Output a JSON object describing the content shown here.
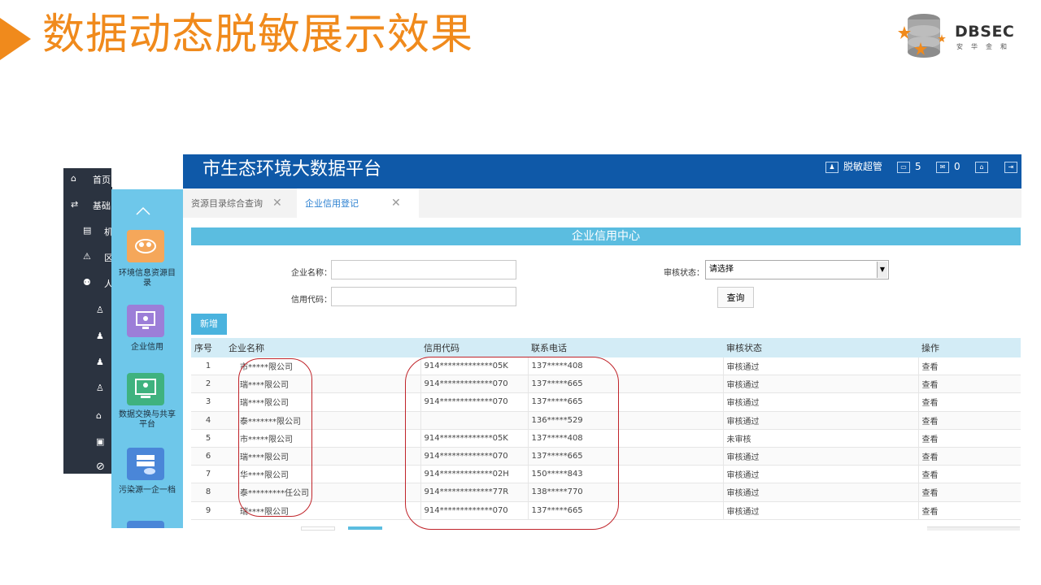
{
  "slide": {
    "title": "数据动态脱敏展示效果",
    "logo_text": "DBSEC",
    "logo_sub": "安华金和"
  },
  "colors": {
    "accent": "#f08a1c",
    "topbar": "#0f59a8",
    "sidebar": "#6ec7ea",
    "highlight": "#c0242a"
  },
  "dark_sidebar": {
    "items": [
      {
        "icon": "home-icon",
        "glyph": "⌂",
        "label": "首页"
      },
      {
        "icon": "swap-icon",
        "glyph": "⇄",
        "label": "基础"
      },
      {
        "icon": "doc-icon",
        "glyph": "▤",
        "label": "机"
      },
      {
        "icon": "region-icon",
        "glyph": "⚠",
        "label": "区"
      },
      {
        "icon": "user-icon",
        "glyph": "⚉",
        "label": "人"
      },
      {
        "icon": "user-outline-icon",
        "glyph": "♙",
        "label": ""
      },
      {
        "icon": "users-icon",
        "glyph": "♟",
        "label": ""
      },
      {
        "icon": "person-icon",
        "glyph": "♟",
        "label": ""
      },
      {
        "icon": "person-outline-icon",
        "glyph": "♙",
        "label": ""
      },
      {
        "icon": "house-icon",
        "glyph": "⌂",
        "label": ""
      },
      {
        "icon": "folder-icon",
        "glyph": "▣",
        "label": ""
      },
      {
        "icon": "ban-icon",
        "glyph": "⊘",
        "label": ""
      }
    ]
  },
  "blue_sidebar": {
    "items": [
      {
        "icon": "cloud-icon",
        "label": "环境信息资源目录"
      },
      {
        "icon": "monitor-icon",
        "label": "企业信用"
      },
      {
        "icon": "exchange-icon",
        "label": "数据交换与共享平台"
      },
      {
        "icon": "server-icon",
        "label": "污染源一企一档"
      }
    ]
  },
  "topbar": {
    "title": "市生态环境大数据平台",
    "user": "脱敏超管",
    "messages": "5",
    "notices": "0"
  },
  "tabs": [
    {
      "label": "资源目录综合查询",
      "active": false
    },
    {
      "label": "企业信用登记",
      "active": true
    }
  ],
  "form": {
    "section_title": "企业信用中心",
    "name_label": "企业名称：",
    "code_label": "信用代码：",
    "status_label": "审核状态：",
    "status_value": "请选择",
    "query_button": "查询",
    "add_button": "新增"
  },
  "table": {
    "headers": [
      "序号",
      "企业名称",
      "信用代码",
      "联系电话",
      "审核状态",
      "操作"
    ],
    "rows": [
      {
        "seq": "1",
        "name": "市*****限公司",
        "code": "914*************05K",
        "phone": "137*****408",
        "status": "审核通过",
        "op": "查看"
      },
      {
        "seq": "2",
        "name": "瑞****限公司",
        "code": "914*************070",
        "phone": "137*****665",
        "status": "审核通过",
        "op": "查看"
      },
      {
        "seq": "3",
        "name": "瑞****限公司",
        "code": "914*************070",
        "phone": "137*****665",
        "status": "审核通过",
        "op": "查看"
      },
      {
        "seq": "4",
        "name": "泰*******限公司",
        "code": "",
        "phone": "136*****529",
        "status": "审核通过",
        "op": "查看"
      },
      {
        "seq": "5",
        "name": "市*****限公司",
        "code": "914*************05K",
        "phone": "137*****408",
        "status": "未审核",
        "op": "查看"
      },
      {
        "seq": "6",
        "name": "瑞****限公司",
        "code": "914*************070",
        "phone": "137*****665",
        "status": "审核通过",
        "op": "查看"
      },
      {
        "seq": "7",
        "name": "华****限公司",
        "code": "914*************02H",
        "phone": "150*****843",
        "status": "审核通过",
        "op": "查看"
      },
      {
        "seq": "8",
        "name": "泰*********任公司",
        "code": "914*************77R",
        "phone": "138*****770",
        "status": "审核通过",
        "op": "查看"
      },
      {
        "seq": "9",
        "name": "瑞****限公司",
        "code": "914*************070",
        "phone": "137*****665",
        "status": "审核通过",
        "op": "查看"
      }
    ]
  }
}
